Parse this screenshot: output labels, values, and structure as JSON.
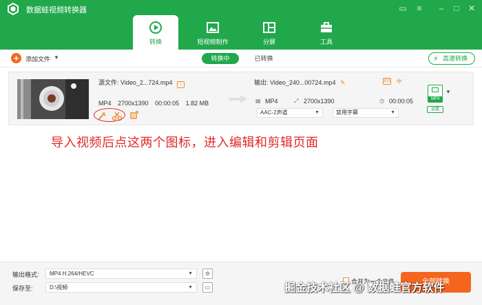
{
  "app": {
    "title": "数据蛙视频转换器",
    "accent_color": "#20a84b",
    "orange_color": "#f4651e"
  },
  "window_controls": [
    "chat-icon",
    "menu-icon",
    "minimize-icon",
    "maximize-icon",
    "close-icon"
  ],
  "main_tabs": [
    {
      "label": "转换",
      "icon": "convert-icon",
      "active": true
    },
    {
      "label": "短视频制作",
      "icon": "video-maker-icon",
      "active": false
    },
    {
      "label": "分屏",
      "icon": "split-screen-icon",
      "active": false
    },
    {
      "label": "工具",
      "icon": "toolbox-icon",
      "active": false
    }
  ],
  "toolbar": {
    "add_file_label": "添加文件",
    "tab_converting": "转换中",
    "tab_converted": "已转换",
    "fast_convert_label": "高速转换"
  },
  "file": {
    "source_prefix": "源文件:",
    "source_name": "Video_2...724.mp4",
    "format": "MP4",
    "resolution": "2700x1390",
    "duration": "00:00:05",
    "size": "1.82 MB",
    "output_prefix": "输出:",
    "output_name": "Video_240...00724.mp4",
    "out_format": "MP4",
    "out_resolution": "2700x1390",
    "out_duration": "00:00:05",
    "audio_option": "AAC-2声道",
    "subtitle_option": "禁用字幕",
    "format_badge": "MP4",
    "preset_label": "设置"
  },
  "annotation": "导入视频后点这两个图标，进入编辑和剪辑页面",
  "bottom": {
    "output_format_label": "输出格式:",
    "output_format_value": "MP4 H.264/HEVC",
    "save_to_label": "保存至:",
    "save_to_value": "D:\\视频",
    "merge_label": "合并为一个文件",
    "convert_all_label": "全部转换"
  },
  "watermark": "掘金技术社区 @ 数据蛙官方软件"
}
